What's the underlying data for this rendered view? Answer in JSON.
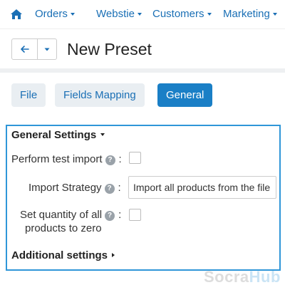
{
  "nav": {
    "items": [
      {
        "label": "Orders"
      },
      {
        "label": "Webstie"
      },
      {
        "label": "Customers"
      },
      {
        "label": "Marketing"
      }
    ]
  },
  "header": {
    "title": "New Preset",
    "back_icon": "arrow-left-icon",
    "dropdown_icon": "caret-down-icon"
  },
  "tabs": [
    {
      "label": "File",
      "active": false
    },
    {
      "label": "Fields Mapping",
      "active": false
    },
    {
      "label": "General",
      "active": true
    }
  ],
  "general_settings": {
    "title": "General Settings",
    "fields": [
      {
        "label": "Perform test import",
        "type": "checkbox",
        "checked": false
      },
      {
        "label": "Import Strategy",
        "type": "select",
        "value": "Import all products from the file"
      },
      {
        "label_line1": "Set quantity of all",
        "label_line2": "products to zero",
        "type": "checkbox",
        "checked": false
      }
    ],
    "help_glyph": "?",
    "colon": ":"
  },
  "additional_settings": {
    "title": "Additional settings"
  },
  "watermark": {
    "part1": "Socra",
    "part2": "Hub"
  },
  "colors": {
    "accent": "#1a7fc6",
    "link": "#1a6fb5",
    "panel_border": "#2f96d8"
  }
}
